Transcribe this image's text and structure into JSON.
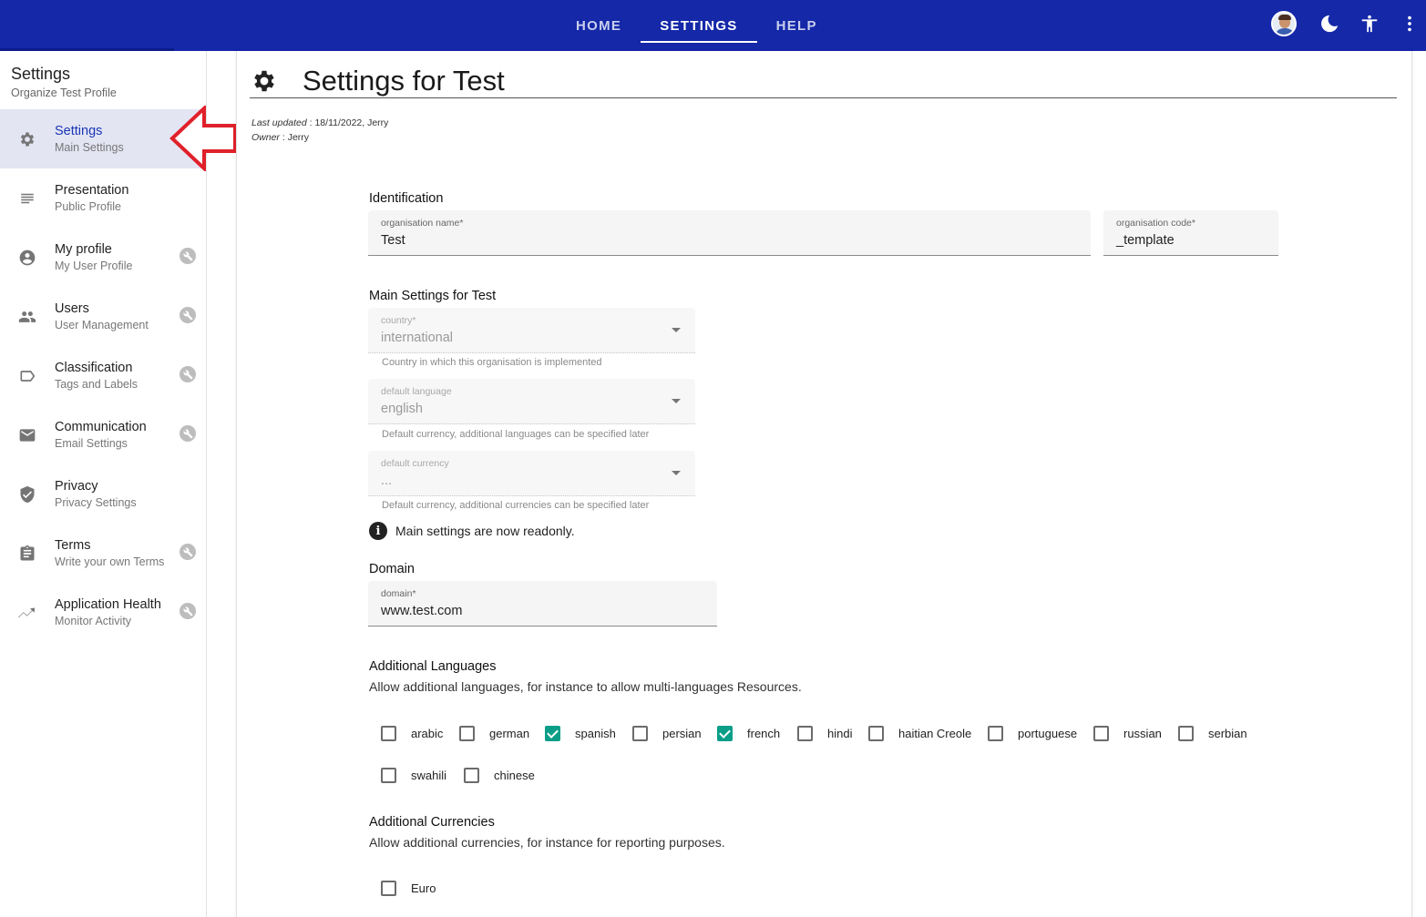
{
  "topnav": {
    "tabs": [
      {
        "label": "HOME",
        "active": false
      },
      {
        "label": "SETTINGS",
        "active": true
      },
      {
        "label": "HELP",
        "active": false
      }
    ],
    "icons": [
      "avatar",
      "dark-mode-moon-icon",
      "accessibility-icon",
      "more-vert-icon"
    ]
  },
  "sidebar": {
    "title": "Settings",
    "subtitle": "Organize Test Profile",
    "items": [
      {
        "label": "Settings",
        "desc": "Main Settings",
        "icon": "gear-icon",
        "active": true,
        "wrench": false
      },
      {
        "label": "Presentation",
        "desc": "Public Profile",
        "icon": "notes-icon",
        "active": false,
        "wrench": false
      },
      {
        "label": "My profile",
        "desc": "My User Profile",
        "icon": "account-circle-icon",
        "active": false,
        "wrench": true
      },
      {
        "label": "Users",
        "desc": "User Management",
        "icon": "people-icon",
        "active": false,
        "wrench": true
      },
      {
        "label": "Classification",
        "desc": "Tags and Labels",
        "icon": "label-icon",
        "active": false,
        "wrench": true
      },
      {
        "label": "Communication",
        "desc": "Email Settings",
        "icon": "mail-icon",
        "active": false,
        "wrench": true
      },
      {
        "label": "Privacy",
        "desc": "Privacy Settings",
        "icon": "shield-check-icon",
        "active": false,
        "wrench": false
      },
      {
        "label": "Terms",
        "desc": "Write your own Terms",
        "icon": "clipboard-icon",
        "active": false,
        "wrench": true
      },
      {
        "label": "Application Health",
        "desc": "Monitor Activity",
        "icon": "trending-icon",
        "active": false,
        "wrench": true
      }
    ]
  },
  "page": {
    "title": "Settings for Test",
    "last_updated_label": "Last updated",
    "last_updated_value": " : 18/11/2022, Jerry",
    "owner_label": "Owner",
    "owner_value": " : Jerry"
  },
  "identification": {
    "title": "Identification",
    "org_name_label": "organisation name*",
    "org_name_value": "Test",
    "org_code_label": "organisation code*",
    "org_code_value": "_template"
  },
  "main_settings": {
    "title": "Main Settings for Test",
    "country_label": "country*",
    "country_value": "international",
    "country_hint": "Country in which this organisation is implemented",
    "language_label": "default language",
    "language_value": "english",
    "language_hint": "Default currency, additional languages can be specified later",
    "currency_label": "default currency",
    "currency_value": "...",
    "currency_hint": "Default currency, additional currencies can be specified later",
    "readonly_note": "Main settings are now readonly."
  },
  "domain": {
    "title": "Domain",
    "label": "domain*",
    "value": "www.test.com"
  },
  "languages": {
    "title": "Additional Languages",
    "desc": "Allow additional languages, for instance to allow multi-languages Resources.",
    "options": [
      {
        "label": "arabic",
        "checked": false
      },
      {
        "label": "german",
        "checked": false
      },
      {
        "label": "spanish",
        "checked": true
      },
      {
        "label": "persian",
        "checked": false
      },
      {
        "label": "french",
        "checked": true
      },
      {
        "label": "hindi",
        "checked": false
      },
      {
        "label": "haitian Creole",
        "checked": false
      },
      {
        "label": "portuguese",
        "checked": false
      },
      {
        "label": "russian",
        "checked": false
      },
      {
        "label": "serbian",
        "checked": false
      },
      {
        "label": "swahili",
        "checked": false
      },
      {
        "label": "chinese",
        "checked": false
      }
    ]
  },
  "currencies": {
    "title": "Additional Currencies",
    "desc": "Allow additional currencies, for instance for reporting purposes.",
    "options": [
      {
        "label": "Euro",
        "checked": false
      }
    ]
  },
  "colors": {
    "topbar": "#1428a8",
    "active_item_bg": "#e3e5f3",
    "checkbox_checked": "#0a9e88",
    "arrow": "#e0202a"
  }
}
